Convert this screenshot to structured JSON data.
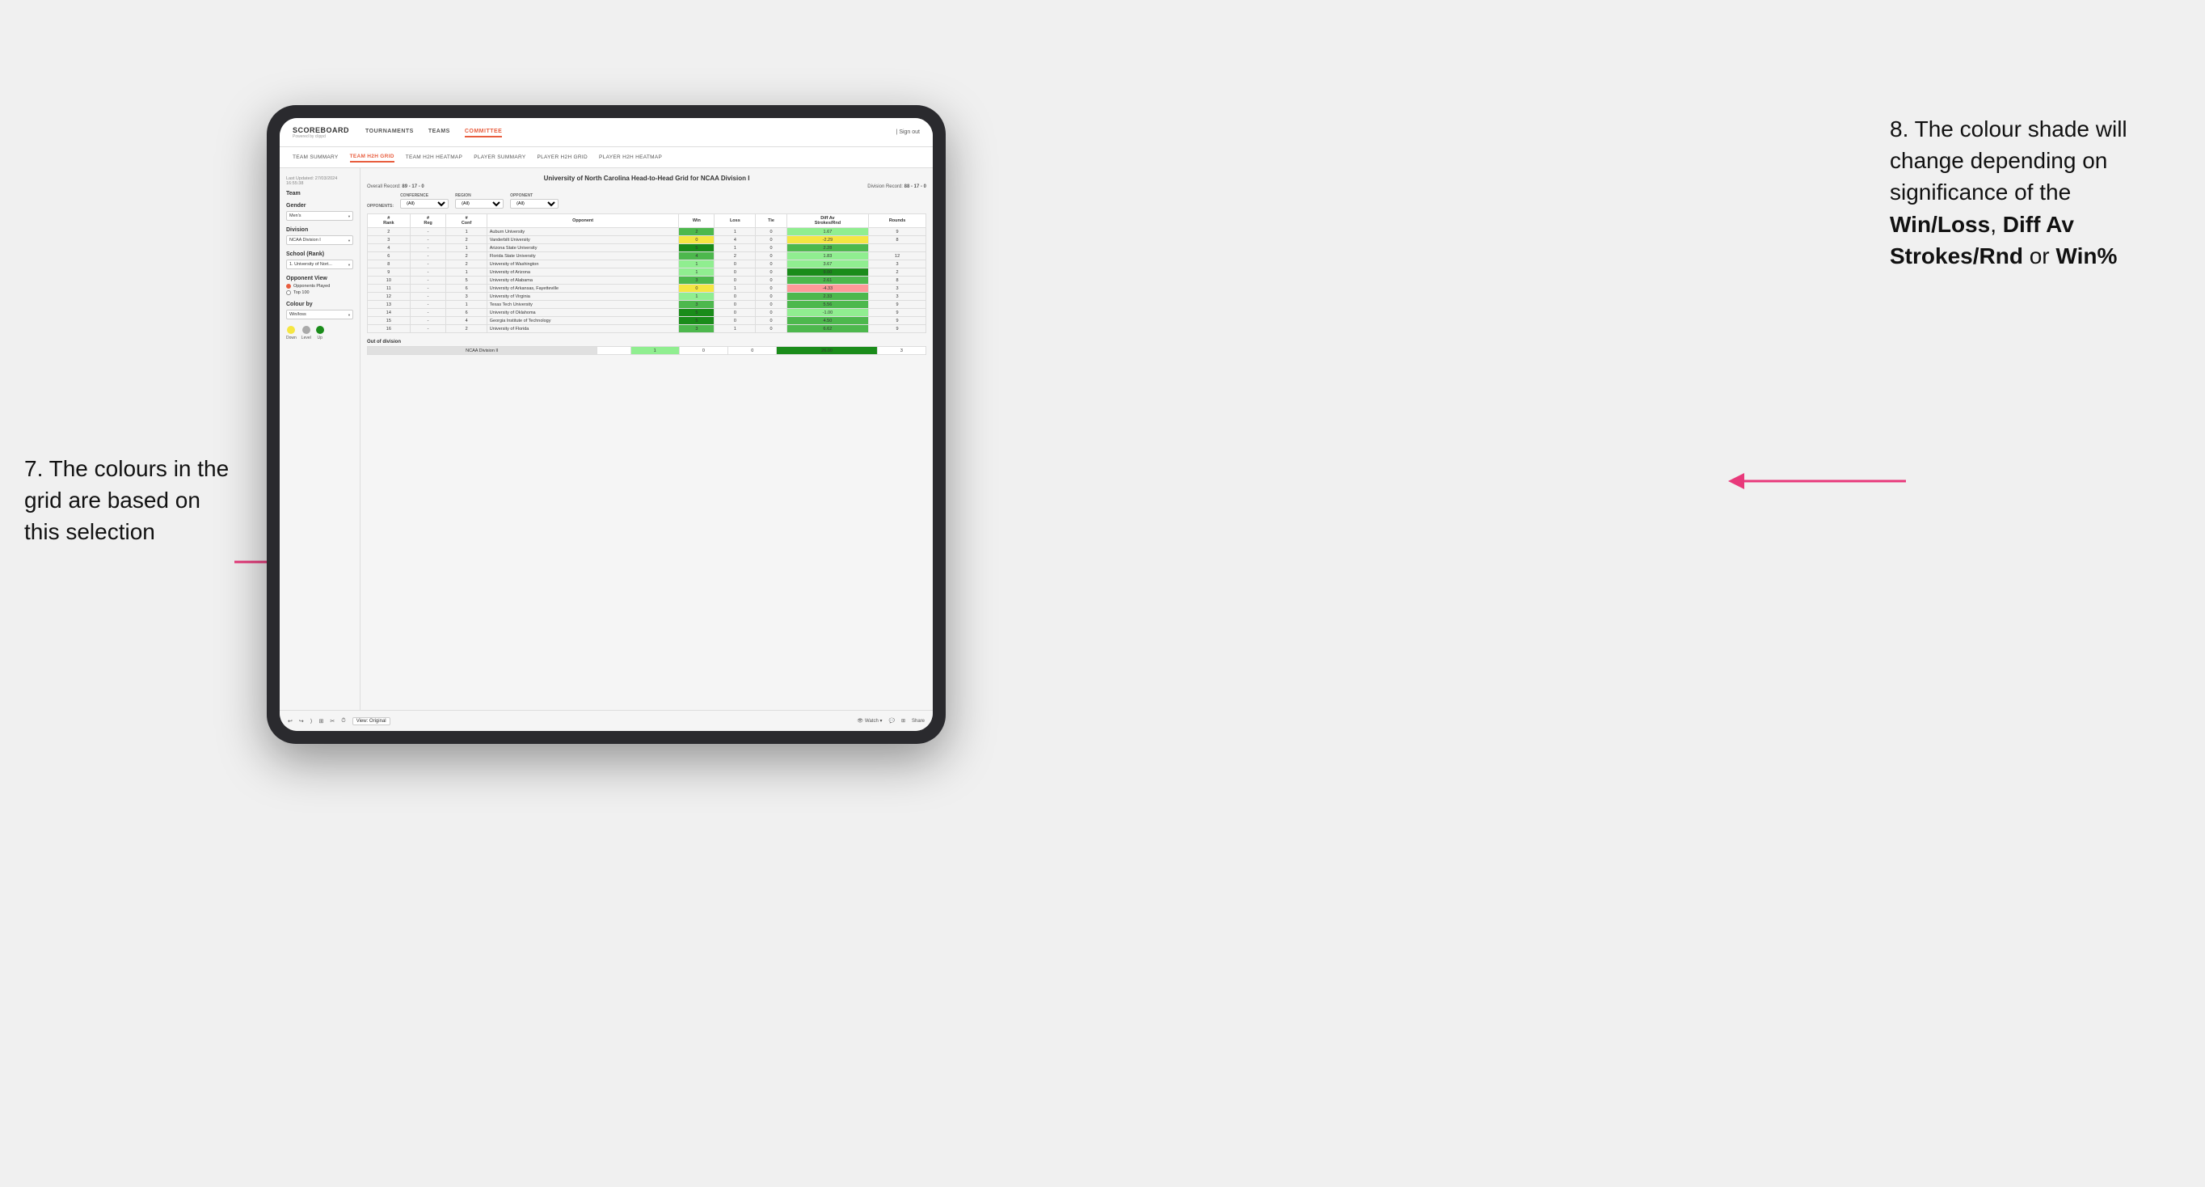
{
  "annotations": {
    "left_title": "7. The colours in the grid are based on this selection",
    "right_title": "8. The colour shade will change depending on significance of the ",
    "right_bold1": "Win/Loss",
    "right_sep1": ", ",
    "right_bold2": "Diff Av Strokes/Rnd",
    "right_sep2": " or ",
    "right_bold3": "Win%"
  },
  "nav": {
    "logo": "SCOREBOARD",
    "logo_sub": "Powered by clippd",
    "links": [
      "TOURNAMENTS",
      "TEAMS",
      "COMMITTEE"
    ],
    "active_link": "COMMITTEE",
    "sign_out": "Sign out"
  },
  "sub_nav": {
    "links": [
      "TEAM SUMMARY",
      "TEAM H2H GRID",
      "TEAM H2H HEATMAP",
      "PLAYER SUMMARY",
      "PLAYER H2H GRID",
      "PLAYER H2H HEATMAP"
    ],
    "active": "TEAM H2H GRID"
  },
  "sidebar": {
    "meta": "Last Updated: 27/03/2024\n16:55:38",
    "team_label": "Team",
    "gender_label": "Gender",
    "gender_value": "Men's",
    "division_label": "Division",
    "division_value": "NCAA Division I",
    "school_label": "School (Rank)",
    "school_value": "1. University of Nort...",
    "opponent_view_label": "Opponent View",
    "opponent_options": [
      "Opponents Played",
      "Top 100"
    ],
    "opponent_selected": "Opponents Played",
    "colour_by_label": "Colour by",
    "colour_by_value": "Win/loss",
    "legend": {
      "down_label": "Down",
      "level_label": "Level",
      "up_label": "Up"
    }
  },
  "grid": {
    "title": "University of North Carolina Head-to-Head Grid for NCAA Division I",
    "overall_record_label": "Overall Record:",
    "overall_record": "89 - 17 - 0",
    "division_record_label": "Division Record:",
    "division_record": "88 - 17 - 0",
    "filters": {
      "opponents_label": "Opponents:",
      "conference_label": "Conference",
      "conference_value": "(All)",
      "region_label": "Region",
      "region_value": "(All)",
      "opponent_label": "Opponent",
      "opponent_value": "(All)"
    },
    "table_headers": [
      "#\nRank",
      "#\nReg",
      "#\nConf",
      "Opponent",
      "Win",
      "Loss",
      "Tie",
      "Diff Av\nStrokes/Rnd",
      "Rounds"
    ],
    "rows": [
      {
        "rank": "2",
        "reg": "-",
        "conf": "1",
        "opponent": "Auburn University",
        "win": "2",
        "loss": "1",
        "tie": "0",
        "diff": "1.67",
        "rounds": "9",
        "win_color": "green-mid",
        "diff_color": "green-light"
      },
      {
        "rank": "3",
        "reg": "-",
        "conf": "2",
        "opponent": "Vanderbilt University",
        "win": "0",
        "loss": "4",
        "tie": "0",
        "diff": "-2.29",
        "rounds": "8",
        "win_color": "yellow",
        "diff_color": "yellow"
      },
      {
        "rank": "4",
        "reg": "-",
        "conf": "1",
        "opponent": "Arizona State University",
        "win": "5",
        "loss": "1",
        "tie": "0",
        "diff": "2.28",
        "rounds": "",
        "win_color": "green-dark",
        "diff_color": "green-mid"
      },
      {
        "rank": "6",
        "reg": "-",
        "conf": "2",
        "opponent": "Florida State University",
        "win": "4",
        "loss": "2",
        "tie": "0",
        "diff": "1.83",
        "rounds": "12",
        "win_color": "green-mid",
        "diff_color": "green-light"
      },
      {
        "rank": "8",
        "reg": "-",
        "conf": "2",
        "opponent": "University of Washington",
        "win": "1",
        "loss": "0",
        "tie": "0",
        "diff": "3.67",
        "rounds": "3",
        "win_color": "green-light",
        "diff_color": "green-light"
      },
      {
        "rank": "9",
        "reg": "-",
        "conf": "1",
        "opponent": "University of Arizona",
        "win": "1",
        "loss": "0",
        "tie": "0",
        "diff": "9.00",
        "rounds": "2",
        "win_color": "green-light",
        "diff_color": "green-dark"
      },
      {
        "rank": "10",
        "reg": "-",
        "conf": "5",
        "opponent": "University of Alabama",
        "win": "3",
        "loss": "0",
        "tie": "0",
        "diff": "2.61",
        "rounds": "8",
        "win_color": "green-mid",
        "diff_color": "green-mid"
      },
      {
        "rank": "11",
        "reg": "-",
        "conf": "6",
        "opponent": "University of Arkansas, Fayetteville",
        "win": "0",
        "loss": "1",
        "tie": "0",
        "diff": "-4.33",
        "rounds": "3",
        "win_color": "yellow",
        "diff_color": "red-light"
      },
      {
        "rank": "12",
        "reg": "-",
        "conf": "3",
        "opponent": "University of Virginia",
        "win": "1",
        "loss": "0",
        "tie": "0",
        "diff": "2.33",
        "rounds": "3",
        "win_color": "green-light",
        "diff_color": "green-mid"
      },
      {
        "rank": "13",
        "reg": "-",
        "conf": "1",
        "opponent": "Texas Tech University",
        "win": "3",
        "loss": "0",
        "tie": "0",
        "diff": "5.56",
        "rounds": "9",
        "win_color": "green-mid",
        "diff_color": "green-mid"
      },
      {
        "rank": "14",
        "reg": "-",
        "conf": "6",
        "opponent": "University of Oklahoma",
        "win": "5",
        "loss": "0",
        "tie": "0",
        "diff": "-1.00",
        "rounds": "9",
        "win_color": "green-dark",
        "diff_color": "green-light"
      },
      {
        "rank": "15",
        "reg": "-",
        "conf": "4",
        "opponent": "Georgia Institute of Technology",
        "win": "5",
        "loss": "0",
        "tie": "0",
        "diff": "4.50",
        "rounds": "9",
        "win_color": "green-dark",
        "diff_color": "green-mid"
      },
      {
        "rank": "16",
        "reg": "-",
        "conf": "2",
        "opponent": "University of Florida",
        "win": "3",
        "loss": "1",
        "tie": "0",
        "diff": "6.62",
        "rounds": "9",
        "win_color": "green-mid",
        "diff_color": "green-mid"
      }
    ],
    "out_of_division_label": "Out of division",
    "out_of_division_row": {
      "label": "NCAA Division II",
      "win": "1",
      "loss": "0",
      "tie": "0",
      "diff": "26.00",
      "rounds": "3",
      "diff_color": "green-dark"
    }
  },
  "bottom_bar": {
    "view_label": "View: Original",
    "watch_label": "Watch ▾",
    "share_label": "Share"
  }
}
